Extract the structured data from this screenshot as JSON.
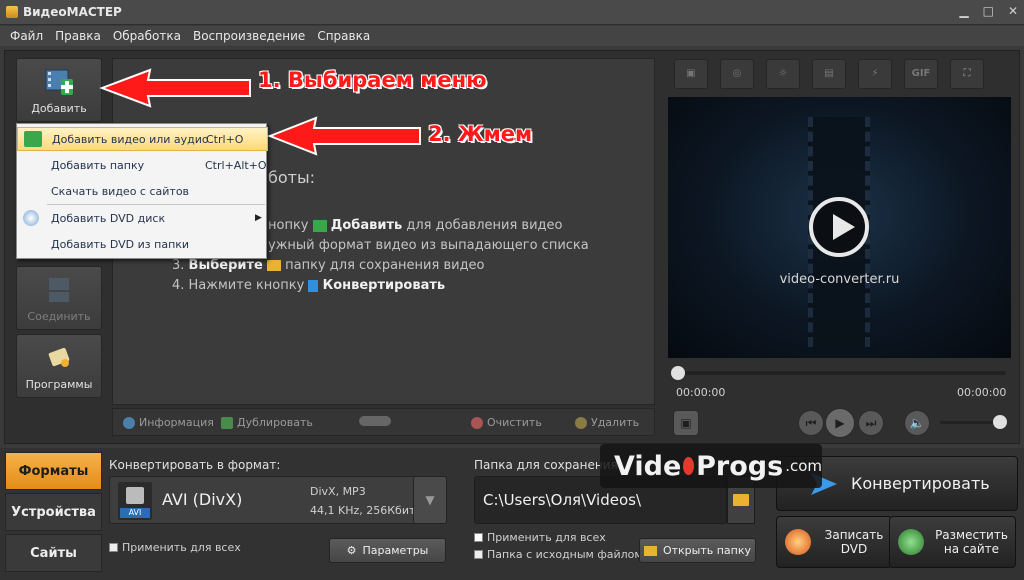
{
  "window": {
    "title": "ВидеоМАСТЕР"
  },
  "menu": [
    "Файл",
    "Правка",
    "Обработка",
    "Воспроизведение",
    "Справка"
  ],
  "sidebar": {
    "add": "Добавить",
    "join": "Соединить",
    "programs": "Программы"
  },
  "dropdown": {
    "items": [
      {
        "label": "Добавить видео или аудио",
        "shortcut": "Ctrl+O"
      },
      {
        "label": "Добавить папку",
        "shortcut": "Ctrl+Alt+O"
      },
      {
        "label": "Скачать видео с сайтов",
        "shortcut": ""
      },
      {
        "label": "Добавить DVD диск",
        "shortcut": ""
      },
      {
        "label": "Добавить DVD из папки",
        "shortcut": ""
      }
    ]
  },
  "workarea": {
    "title_fragment": "боты:",
    "step1_pre": "нопку",
    "step1_bold": "Добавить",
    "step1_post": "для добавления видео",
    "step2": "ужный формат видео из выпадающего списка",
    "step3_pre": "3.",
    "step3_bold": "Выберите",
    "step3_post": "папку для сохранения видео",
    "step4_pre": "4. Нажмите кнопку",
    "step4_bold": "Конвертировать"
  },
  "listbar": {
    "info": "Информация",
    "duplicate": "Дублировать",
    "clear": "Очистить",
    "delete": "Удалить"
  },
  "preview": {
    "gif_label": "GIF",
    "site": "video-converter.ru",
    "time_start": "00:00:00",
    "time_end": "00:00:00"
  },
  "tabs": [
    "Форматы",
    "Устройства",
    "Сайты"
  ],
  "format": {
    "label": "Конвертировать в формат:",
    "name": "AVI (DivX)",
    "codec": "DivX, MP3",
    "params": "44,1 KHz, 256Кбит",
    "badge": "AVI",
    "apply_all": "Применить для всех",
    "params_btn": "Параметры"
  },
  "output": {
    "label": "Папка для сохранения:",
    "path": "C:\\Users\\Оля\\Videos\\",
    "apply_all": "Применить для всех",
    "source_folder": "Папка с исходным файлом",
    "open_btn": "Открыть папку"
  },
  "actions": {
    "convert": "Конвертировать",
    "dvd_line1": "Записать",
    "dvd_line2": "DVD",
    "upload_line1": "Разместить",
    "upload_line2": "на сайте"
  },
  "annotations": {
    "a1": "1. Выбираем меню",
    "a2": "2. Жмем"
  },
  "watermark": {
    "text1": "Vide",
    "text2": "Progs",
    "text3": ".com"
  },
  "colors": {
    "accent": "#f0a030",
    "annotation": "#ff1a1a",
    "menu_highlight": "#ffd97a"
  }
}
